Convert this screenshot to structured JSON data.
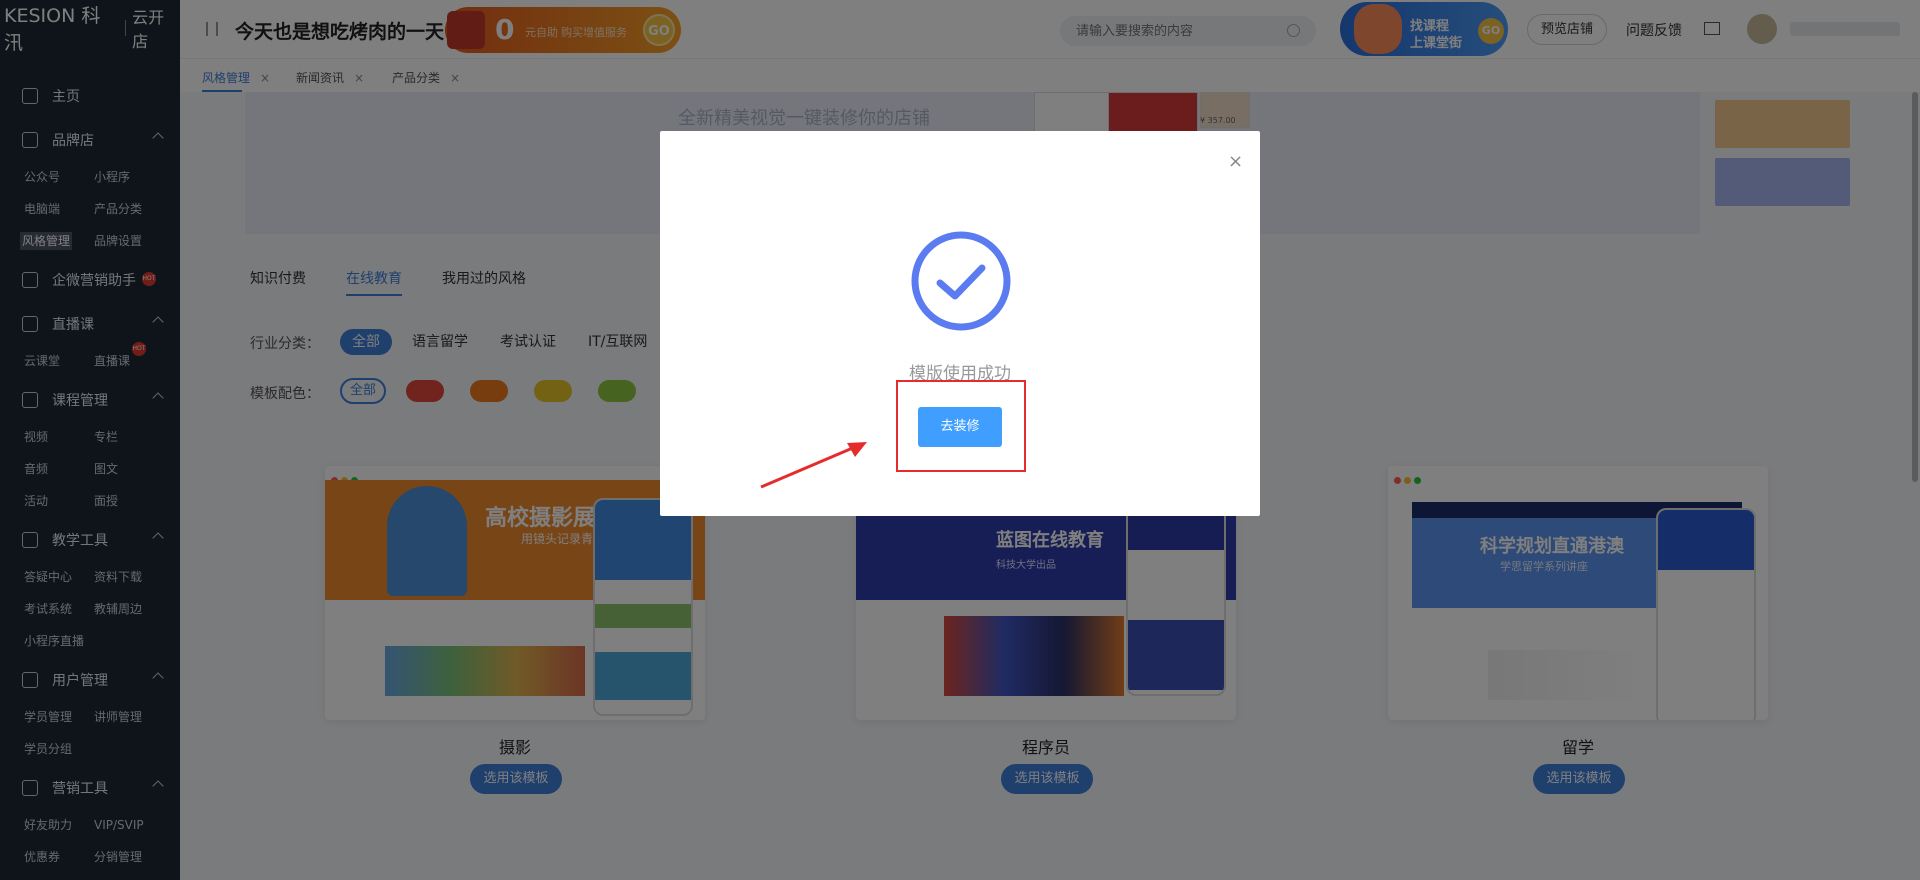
{
  "brand": {
    "name": "KESION 科汛",
    "sub": "云开店"
  },
  "sidebar": {
    "home": "主页",
    "sections": [
      {
        "label": "品牌店",
        "items": [
          "公众号",
          "小程序",
          "电脑端",
          "产品分类",
          "风格管理",
          "品牌设置"
        ]
      },
      {
        "label": "企微营销助手",
        "items": []
      },
      {
        "label": "直播课",
        "items": [
          "云课堂",
          "直播课"
        ]
      },
      {
        "label": "课程管理",
        "items": [
          "视频",
          "专栏",
          "音频",
          "图文",
          "活动",
          "面授"
        ]
      },
      {
        "label": "教学工具",
        "items": [
          "答疑中心",
          "资料下载",
          "考试系统",
          "教辅周边",
          "小程序直播"
        ]
      },
      {
        "label": "用户管理",
        "items": [
          "学员管理",
          "讲师管理",
          "学员分组"
        ]
      },
      {
        "label": "营销工具",
        "items": [
          "好友助力",
          "VIP/SVIP",
          "优惠券",
          "分销管理"
        ]
      }
    ],
    "hot": "HOT"
  },
  "header": {
    "slogan": "今天也是想吃烤肉的一天",
    "promo": {
      "number": "0",
      "text1": "元自助",
      "text2": "购买增值服务",
      "go": "GO"
    },
    "search_placeholder": "请输入要搜索的内容",
    "banner": {
      "line1": "找课程",
      "line2": "上课堂街",
      "go": "GO"
    },
    "preview_store": "预览店铺",
    "feedback": "问题反馈"
  },
  "tabs": [
    {
      "label": "风格管理",
      "close": "×"
    },
    {
      "label": "新闻资讯",
      "close": "×"
    },
    {
      "label": "产品分类",
      "close": "×"
    }
  ],
  "hero": {
    "text": "全新精美视觉一键装修你的店铺",
    "price": "¥ 357.00"
  },
  "category_tabs": [
    "知识付费",
    "在线教育",
    "我用过的风格"
  ],
  "filters": {
    "industry_label": "行业分类：",
    "industry": [
      "全部",
      "语言留学",
      "考试认证",
      "IT/互联网"
    ],
    "color_label": "模板配色：",
    "color_all": "全部",
    "colors": [
      "#e0483a",
      "#f07a1e",
      "#e6c229",
      "#8cc63f"
    ]
  },
  "templates": [
    {
      "title": "摄影",
      "button": "选用该模板",
      "headline": "高校摄影展",
      "subline": "用镜头记录青春"
    },
    {
      "title": "程序员",
      "button": "选用该模板",
      "headline": "蓝图在线教育",
      "subline": "科技大学出品"
    },
    {
      "title": "留学",
      "button": "选用该模板",
      "headline": "科学规划直通港澳",
      "subline": "学思留学系列讲座"
    }
  ],
  "modal": {
    "message": "模版使用成功",
    "button": "去装修",
    "close": "×"
  }
}
